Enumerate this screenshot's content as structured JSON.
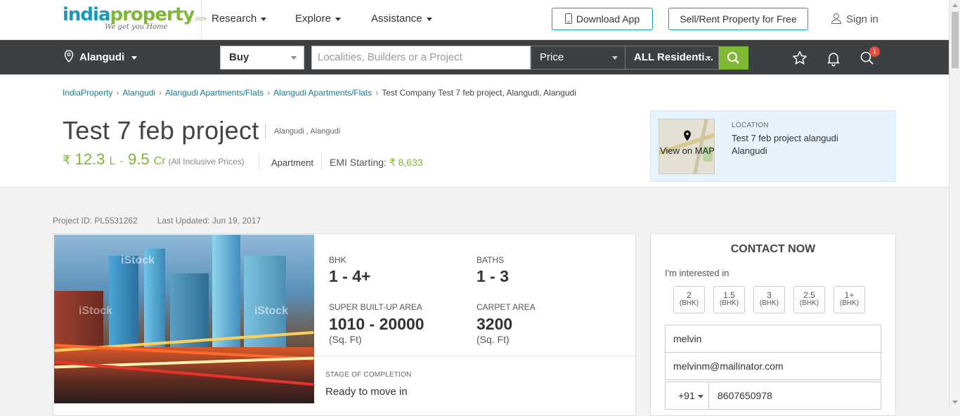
{
  "topbar": {
    "logo_part1": "india",
    "logo_part2": "property",
    "logo_com": ".com",
    "logo_tagline": "We get you Home",
    "nav": [
      "Research",
      "Explore",
      "Assistance"
    ],
    "download_app": "Download App",
    "sell_rent": "Sell/Rent Property for Free",
    "sign_in": "Sign in"
  },
  "searchbar": {
    "city": "Alangudi",
    "mode": "Buy",
    "search_placeholder": "Localities, Builders or a Project",
    "price": "Price",
    "property_type": "ALL Residenti...",
    "notification_count": "1"
  },
  "breadcrumb": [
    "IndiaProperty",
    "Alangudi",
    "Alangudi Apartments/Flats",
    "Alangudi Apartments/Flats",
    "Test Company Test 7 feb project, Alangudi, Alangudi"
  ],
  "project": {
    "title": "Test 7 feb project",
    "location": "Alangudi , Alangudi",
    "currency": "₹",
    "price_min": "12.3",
    "price_min_unit": "L",
    "price_dash": "-",
    "price_max": "9.5",
    "price_max_unit": "Cr",
    "price_note": "(All Inclusive Prices)",
    "type": "Apartment",
    "emi_label": "EMI Starting:",
    "emi_value": "₹ 8,633"
  },
  "location_box": {
    "view_map": "View on MAP",
    "heading": "LOCATION",
    "line1": "Test 7 feb project alangudi",
    "line2": "Alangudi"
  },
  "meta": {
    "project_id": "Project ID: PL5531262",
    "last_updated": "Last Updated: Jun 19, 2017"
  },
  "specs": {
    "bhk_label": "BHK",
    "bhk_value": "1 - 4+",
    "baths_label": "BATHS",
    "baths_value": "1 - 3",
    "super_area_label": "SUPER BUILT-UP AREA",
    "super_area_value": "1010 - 20000",
    "super_area_unit": "(Sq. Ft)",
    "carpet_area_label": "CARPET AREA",
    "carpet_area_value": "3200",
    "carpet_area_unit": "(Sq. Ft)",
    "stage_label": "STAGE OF COMPLETION",
    "stage_value": "Ready to move in",
    "watermark": "iStock"
  },
  "contact": {
    "title": "CONTACT NOW",
    "interest_label": "I'm interested in",
    "options": [
      {
        "num": "2",
        "unit": "(BHK)"
      },
      {
        "num": "1.5",
        "unit": "(BHK)"
      },
      {
        "num": "3",
        "unit": "(BHK)"
      },
      {
        "num": "2.5",
        "unit": "(BHK)"
      },
      {
        "num": "1+",
        "unit": "(BHK)"
      }
    ],
    "name_value": "melvin",
    "email_value": "melvinm@mailinator.com",
    "country_code": "+91",
    "phone_value": "8607650978"
  },
  "colors": {
    "brand_blue": "#1a99b5",
    "brand_green": "#7fb833",
    "searchbar_bg": "#3d4043"
  }
}
